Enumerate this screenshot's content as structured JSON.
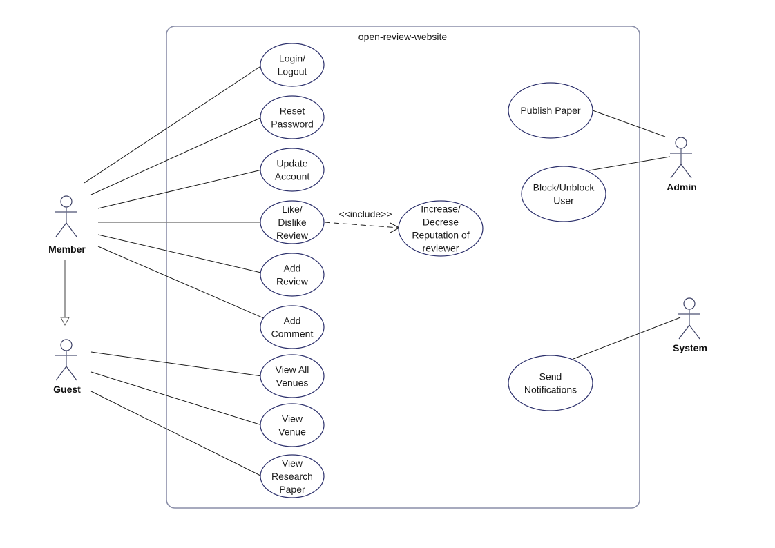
{
  "diagram": {
    "type": "use-case",
    "system_boundary_title": "open-review-website",
    "colors": {
      "boundary": "#8a8ea8",
      "ellipse_stroke": "#2b2f6b",
      "actor_stroke": "#3a3e63",
      "association": "#1a1a1a",
      "generalization": "#808080",
      "text": "#1a1a1a"
    },
    "actors": [
      {
        "id": "member",
        "label": "Member"
      },
      {
        "id": "guest",
        "label": "Guest"
      },
      {
        "id": "admin",
        "label": "Admin"
      },
      {
        "id": "system",
        "label": "System"
      }
    ],
    "use_cases": [
      {
        "id": "login",
        "lines": [
          "Login/",
          "Logout"
        ]
      },
      {
        "id": "reset",
        "lines": [
          "Reset",
          "Password"
        ]
      },
      {
        "id": "update",
        "lines": [
          "Update",
          "Account"
        ]
      },
      {
        "id": "like",
        "lines": [
          "Like/",
          "Dislike",
          "Review"
        ]
      },
      {
        "id": "addreview",
        "lines": [
          "Add",
          "Review"
        ]
      },
      {
        "id": "addcomment",
        "lines": [
          "Add",
          "Comment"
        ]
      },
      {
        "id": "viewall",
        "lines": [
          "View All",
          "Venues"
        ]
      },
      {
        "id": "viewvenue",
        "lines": [
          "View",
          "Venue"
        ]
      },
      {
        "id": "viewpaper",
        "lines": [
          "View",
          "Research",
          "Paper"
        ]
      },
      {
        "id": "reputation",
        "lines": [
          "Increase/",
          "Decrese",
          "Reputation of",
          "reviewer"
        ]
      },
      {
        "id": "publish",
        "lines": [
          "Publish Paper"
        ]
      },
      {
        "id": "block",
        "lines": [
          "Block/Unblock",
          "User"
        ]
      },
      {
        "id": "notify",
        "lines": [
          "Send",
          "Notifications"
        ]
      }
    ],
    "associations": [
      {
        "from": "member",
        "to": "login"
      },
      {
        "from": "member",
        "to": "reset"
      },
      {
        "from": "member",
        "to": "update"
      },
      {
        "from": "member",
        "to": "like"
      },
      {
        "from": "member",
        "to": "addreview"
      },
      {
        "from": "member",
        "to": "addcomment"
      },
      {
        "from": "guest",
        "to": "viewall"
      },
      {
        "from": "guest",
        "to": "viewvenue"
      },
      {
        "from": "guest",
        "to": "viewpaper"
      },
      {
        "from": "admin",
        "to": "publish"
      },
      {
        "from": "admin",
        "to": "block"
      },
      {
        "from": "system",
        "to": "notify"
      }
    ],
    "include": {
      "from": "like",
      "to": "reputation",
      "label": "<<include>>"
    },
    "generalization": {
      "from": "member",
      "to": "guest"
    }
  }
}
